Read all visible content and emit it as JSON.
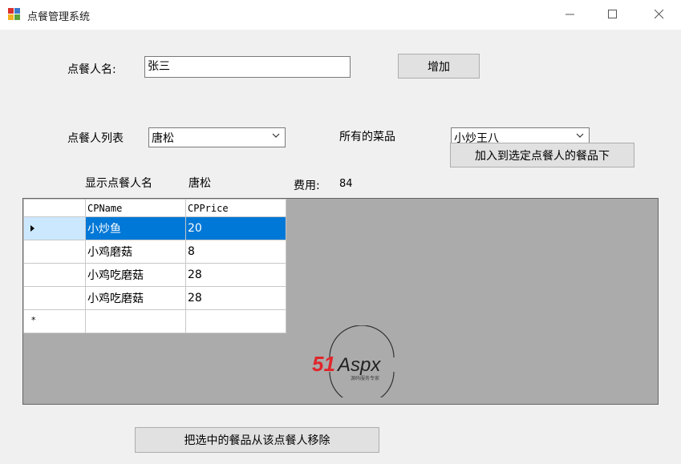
{
  "window": {
    "title": "点餐管理系统"
  },
  "form": {
    "customer_name_label": "点餐人名:",
    "customer_name_value": "张三",
    "add_button": "增加",
    "customer_list_label": "点餐人列表",
    "customer_list_selected": "唐松",
    "all_dishes_label": "所有的菜品",
    "all_dishes_selected": "小炒王八",
    "show_name_label": "显示点餐人名",
    "show_name_value": "唐松",
    "fee_label": "费用:",
    "fee_value": "84",
    "add_to_customer_button": "加入到选定点餐人的餐品下",
    "remove_button": "把选中的餐品从该点餐人移除"
  },
  "grid": {
    "columns": [
      "CPName",
      "CPPrice"
    ],
    "rows": [
      {
        "name": "小炒鱼",
        "price": "20",
        "selected": true
      },
      {
        "name": "小鸡磨菇",
        "price": "8"
      },
      {
        "name": "小鸡吃磨菇",
        "price": "28"
      },
      {
        "name": "小鸡吃磨菇",
        "price": "28"
      }
    ],
    "new_row_marker": "*"
  },
  "watermark": {
    "brand": "51Aspx",
    "subtitle": "源码服务专家"
  },
  "colors": {
    "selection": "#0078d7",
    "grid_background": "#ababab",
    "brand_red": "#e0262b",
    "brand_green": "#3aa935"
  }
}
